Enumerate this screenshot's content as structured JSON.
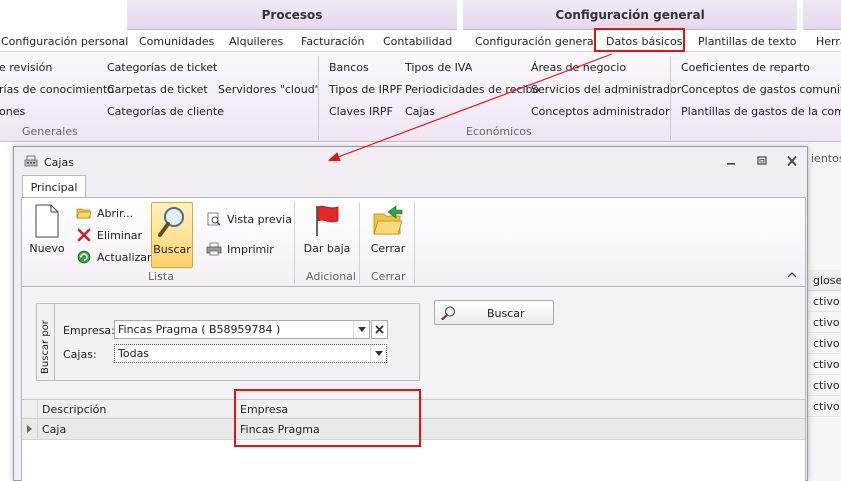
{
  "ribbon": {
    "groups": [
      {
        "label": "Procesos"
      },
      {
        "label": "Configuración general"
      }
    ],
    "tabs": [
      {
        "label": "Configuración personal"
      },
      {
        "label": "Comunidades"
      },
      {
        "label": "Alquileres"
      },
      {
        "label": "Facturación"
      },
      {
        "label": "Contabilidad"
      },
      {
        "label": "Configuración general"
      },
      {
        "label": "Datos básicos"
      },
      {
        "label": "Plantillas de texto"
      },
      {
        "label": "Herra"
      }
    ],
    "generales": {
      "items": [
        "e revisión",
        "rías de conocimiento",
        "ones",
        "Categorías de ticket",
        "Carpetas de ticket",
        "Categorías de cliente",
        "Servidores \"cloud\""
      ],
      "group_label": "Generales"
    },
    "economicos": {
      "items": [
        "Bancos",
        "Tipos de IRPF",
        "Claves IRPF",
        "Tipos de IVA",
        "Periodicidades de recibo",
        "Cajas",
        "Áreas de negocio",
        "Servicios del administrador",
        "Conceptos administrador"
      ],
      "group_label": "Económicos"
    },
    "reparto": {
      "items": [
        "Coeficientes de reparto",
        "Conceptos de gastos comunitario",
        "Plantillas de gastos de la comunid"
      ]
    }
  },
  "right_panel": {
    "top_text": "ientos",
    "header": "glose",
    "cells": [
      "ctivo:",
      "ctivo:",
      "ctivo:",
      "ctivo:",
      "ctivo:",
      "ctivo:"
    ]
  },
  "window": {
    "title": "Cajas",
    "tab": "Principal",
    "toolbar": {
      "nuevo": "Nuevo",
      "abrir": "Abrir...",
      "eliminar": "Eliminar",
      "actualizar": "Actualizar",
      "buscar": "Buscar",
      "vista_previa": "Vista previa",
      "imprimir": "Imprimir",
      "dar_baja": "Dar baja",
      "cerrar": "Cerrar",
      "group_lista": "Lista",
      "group_adicional": "Adicional",
      "group_cerrar": "Cerrar"
    },
    "filter": {
      "legend": "Buscar por",
      "empresa_label": "Empresa:",
      "empresa_value": "Fincas Pragma ( B58959784 )",
      "cajas_label": "Cajas:",
      "cajas_value": "Todas",
      "search_button": "Buscar"
    },
    "grid": {
      "columns": [
        "Descripción",
        "Empresa"
      ],
      "rows": [
        {
          "descripcion": "Caja",
          "empresa": "Fincas Pragma"
        }
      ]
    }
  },
  "colors": {
    "highlight": "#e21515",
    "ribbon_header": "#e6d8ee",
    "active_button": "#ffd26b"
  }
}
